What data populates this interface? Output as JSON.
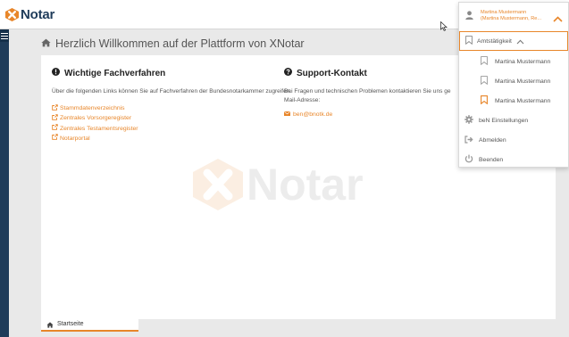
{
  "header": {
    "logo_text": "Notar"
  },
  "page": {
    "title": "Herzlich Willkommen auf der Plattform von XNotar"
  },
  "fachverfahren": {
    "title": "Wichtige Fachverfahren",
    "intro": "Über die folgenden Links können Sie auf Fachverfahren der Bundesnotarkammer zugreifen.",
    "links": [
      "Stammdatenverzeichnis",
      "Zentrales Vorsorgeregister",
      "Zentrales Testamentsregister",
      "Notarportal"
    ]
  },
  "support": {
    "title": "Support-Kontakt",
    "intro": "Bei Fragen und technischen Problemen kontaktieren Sie uns ge",
    "intro2": "Mail-Adresse:",
    "email": "ben@bnotk.de"
  },
  "watermark": {
    "text": "Notar"
  },
  "tabs": {
    "home": "Startseite"
  },
  "dropdown": {
    "user_line1": "Martina Mustermann",
    "user_line2": "(Martina Mustermann, Re...",
    "amtstaetigkeit": "Amtstätigkeit",
    "persons": [
      "Martina Mustermann",
      "Martina Mustermann",
      "Martina Mustermann"
    ],
    "settings": "beN Einstellungen",
    "logout": "Abmelden",
    "quit": "Beenden"
  },
  "colors": {
    "accent": "#e8862a",
    "navy": "#1f3c5a"
  }
}
